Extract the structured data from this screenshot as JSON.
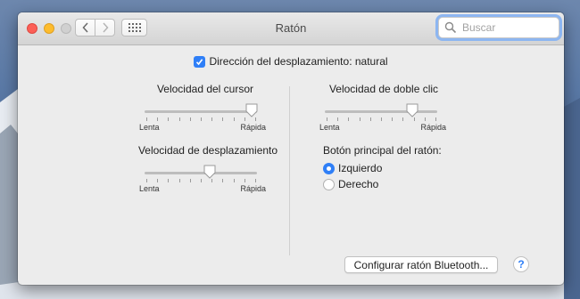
{
  "window": {
    "title": "Ratón"
  },
  "search": {
    "placeholder": "Buscar"
  },
  "natural_scroll": {
    "label": "Dirección del desplazamiento: natural",
    "checked": true
  },
  "cursor_speed": {
    "label": "Velocidad del cursor",
    "min_label": "Lenta",
    "max_label": "Rápida",
    "value": 0.95
  },
  "scroll_speed": {
    "label": "Velocidad de desplazamiento",
    "min_label": "Lenta",
    "max_label": "Rápida",
    "value": 0.58
  },
  "double_click_speed": {
    "label": "Velocidad de doble clic",
    "min_label": "Lenta",
    "max_label": "Rápida",
    "value": 0.78
  },
  "primary_button": {
    "label": "Botón principal del ratón:",
    "options": [
      {
        "label": "Izquierdo",
        "selected": true
      },
      {
        "label": "Derecho",
        "selected": false
      }
    ]
  },
  "bluetooth_button": {
    "label": "Configurar ratón Bluetooth..."
  },
  "help_button": {
    "label": "?"
  },
  "colors": {
    "accent": "#2f7ff7",
    "window_bg": "#ececec"
  },
  "icons": [
    "back-arrow-icon",
    "forward-arrow-icon",
    "show-all-grid-icon",
    "search-icon",
    "checkmark-icon",
    "help-icon"
  ]
}
